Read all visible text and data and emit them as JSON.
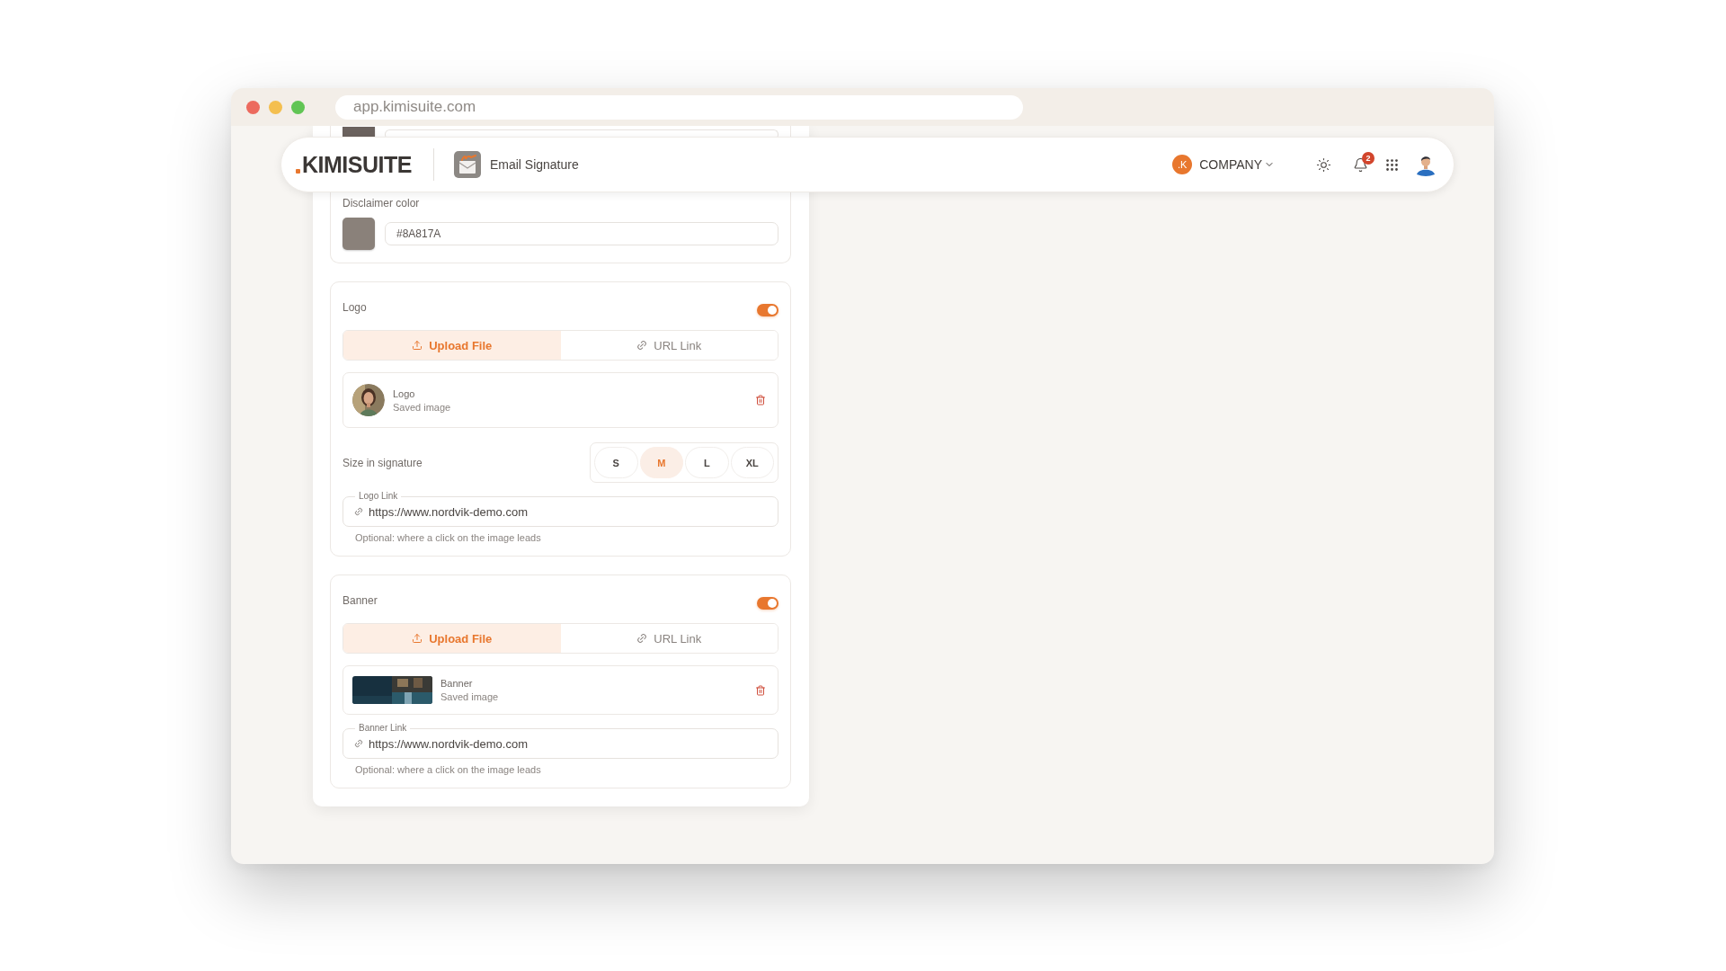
{
  "browser": {
    "url": "app.kimisuite.com"
  },
  "header": {
    "logo": "KIMISUITE",
    "app_title": "Email Signature",
    "company_badge": ".K",
    "company": "COMPANY",
    "notification_count": "2"
  },
  "color_section": {
    "rows": [
      {
        "color": "#6b625e"
      },
      {
        "label": "Disclaimer color",
        "color": "#8a817a",
        "value": "#8A817A"
      }
    ]
  },
  "media_sections": [
    {
      "title": "Logo",
      "enabled": true,
      "tabs": [
        {
          "label": "Upload File",
          "kind": "upload",
          "selected": true
        },
        {
          "label": "URL Link",
          "kind": "link",
          "selected": false
        }
      ],
      "file": {
        "kind": "portrait",
        "name": "Logo",
        "status": "Saved image"
      },
      "sizes": {
        "label": "Size in signature",
        "options": [
          {
            "label": "S",
            "selected": false
          },
          {
            "label": "M",
            "selected": true
          },
          {
            "label": "L",
            "selected": false
          },
          {
            "label": "XL",
            "selected": false
          }
        ]
      },
      "link": {
        "label": "Logo Link",
        "value": "https://www.nordvik-demo.com",
        "hint": "Optional: where a click on the image leads"
      }
    },
    {
      "title": "Banner",
      "enabled": true,
      "tabs": [
        {
          "label": "Upload File",
          "kind": "upload",
          "selected": true
        },
        {
          "label": "URL Link",
          "kind": "link",
          "selected": false
        }
      ],
      "file": {
        "kind": "banner",
        "name": "Banner",
        "status": "Saved image"
      },
      "link": {
        "label": "Banner Link",
        "value": "https://www.nordvik-demo.com",
        "hint": "Optional: where a click on the image leads"
      }
    }
  ]
}
